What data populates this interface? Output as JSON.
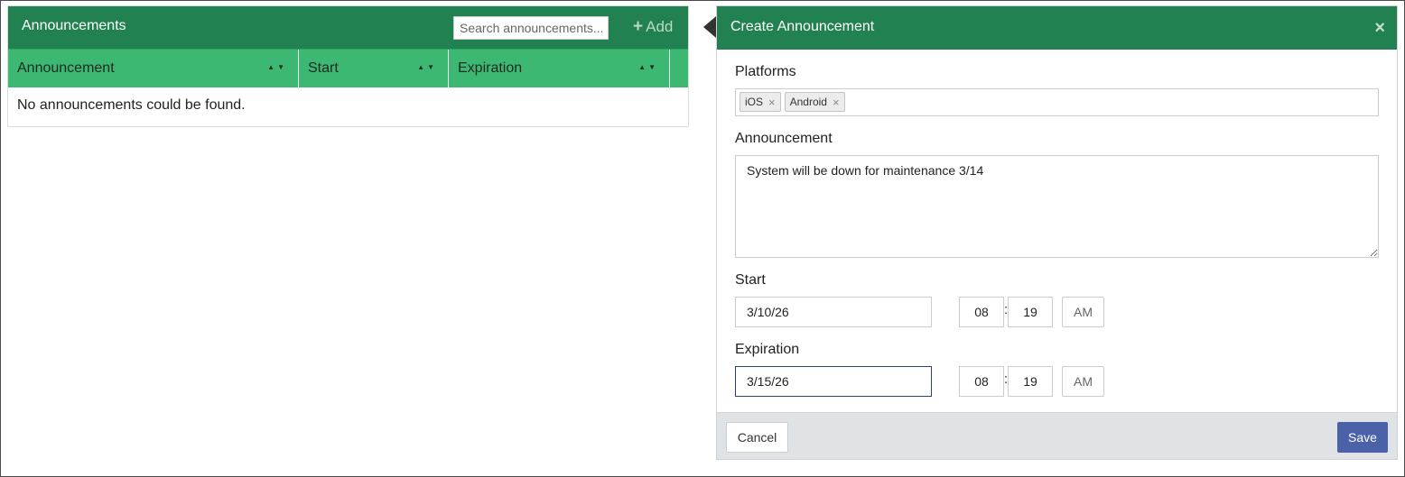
{
  "list": {
    "title": "Announcements",
    "search_placeholder": "Search announcements...",
    "add_icon": "plus-icon",
    "add_label": "Add",
    "columns": [
      {
        "label": "Announcement",
        "sort_icon": "sort-icon"
      },
      {
        "label": "Start",
        "sort_icon": "sort-icon"
      },
      {
        "label": "Expiration",
        "sort_icon": "sort-icon"
      }
    ],
    "empty_message": "No announcements could be found."
  },
  "dialog": {
    "title": "Create Announcement",
    "close_icon": "close-icon",
    "platforms": {
      "label": "Platforms",
      "tags": [
        "iOS",
        "Android"
      ],
      "remove_icon": "×"
    },
    "announcement": {
      "label": "Announcement",
      "value": "System will be down for maintenance 3/14"
    },
    "start": {
      "label": "Start",
      "date": "3/10/26",
      "hour": "08",
      "minute": "19",
      "period": "AM"
    },
    "expiration": {
      "label": "Expiration",
      "date": "3/15/26",
      "hour": "08",
      "minute": "19",
      "period": "AM"
    },
    "footer": {
      "cancel_label": "Cancel",
      "save_label": "Save"
    }
  },
  "colors": {
    "header_green": "#228150",
    "column_green": "#3db873",
    "save_blue": "#4b61a8",
    "footer_gray": "#dfe3e6"
  }
}
